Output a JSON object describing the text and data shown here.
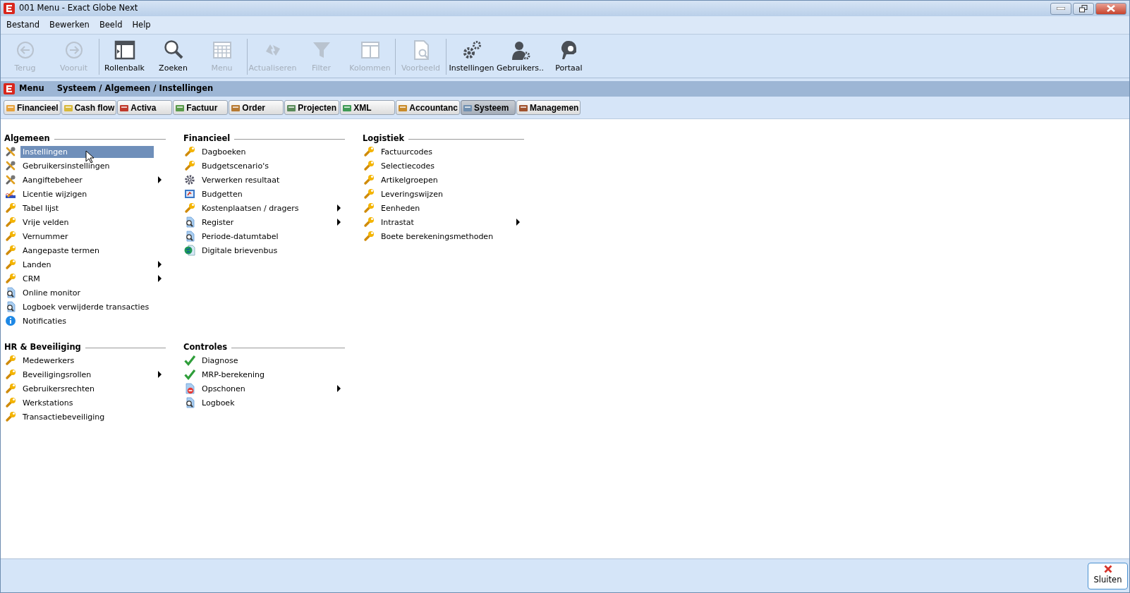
{
  "window": {
    "title": "001 Menu - Exact Globe Next"
  },
  "menu_bar": [
    {
      "label": "Bestand"
    },
    {
      "label": "Bewerken"
    },
    {
      "label": "Beeld"
    },
    {
      "label": "Help"
    }
  ],
  "toolbar": {
    "groups": [
      [
        {
          "label": "Terug",
          "kind": "back",
          "disabled": true
        },
        {
          "label": "Vooruit",
          "kind": "forward",
          "disabled": true
        }
      ],
      [
        {
          "label": "Rollenbalk",
          "kind": "sidebar",
          "disabled": false
        },
        {
          "label": "Zoeken",
          "kind": "search",
          "disabled": false
        },
        {
          "label": "Menu",
          "kind": "grid",
          "disabled": true
        }
      ],
      [
        {
          "label": "Actualiseren",
          "kind": "refresh",
          "disabled": true
        },
        {
          "label": "Filter",
          "kind": "filter",
          "disabled": true
        },
        {
          "label": "Kolommen",
          "kind": "columns",
          "disabled": true
        }
      ],
      [
        {
          "label": "Voorbeeld",
          "kind": "preview",
          "disabled": true
        }
      ],
      [
        {
          "label": "Instellingen",
          "kind": "settings",
          "disabled": false
        },
        {
          "label": "Gebruikers..",
          "kind": "users",
          "disabled": false
        },
        {
          "label": "Portaal",
          "kind": "support",
          "disabled": false
        }
      ]
    ]
  },
  "breadcrumb": {
    "title": "Menu",
    "path": "Systeem / Algemeen / Instellingen"
  },
  "module_tabs": [
    {
      "label": "Financieel",
      "selected": false
    },
    {
      "label": "Cash flow",
      "selected": false
    },
    {
      "label": "Activa",
      "selected": false
    },
    {
      "label": "Factuur",
      "selected": false
    },
    {
      "label": "Order",
      "selected": false
    },
    {
      "label": "Projecten",
      "selected": false
    },
    {
      "label": "XML",
      "selected": false
    },
    {
      "label": "Accountanc",
      "selected": false
    },
    {
      "label": "Systeem",
      "selected": true
    },
    {
      "label": "Managemen",
      "selected": false
    }
  ],
  "section_rows": [
    [
      {
        "title": "Algemeen",
        "items": [
          {
            "label": "Instellingen",
            "kind": "tools",
            "selected": true,
            "has_submenu": false
          },
          {
            "label": "Gebruikersinstellingen",
            "kind": "tools",
            "selected": false,
            "has_submenu": false
          },
          {
            "label": "Aangiftebeheer",
            "kind": "tools",
            "selected": false,
            "has_submenu": true
          },
          {
            "label": "Licentie wijzigen",
            "kind": "pen",
            "selected": false,
            "has_submenu": false
          },
          {
            "label": "Tabel lijst",
            "kind": "wrench",
            "selected": false,
            "has_submenu": false
          },
          {
            "label": "Vrije velden",
            "kind": "wrench",
            "selected": false,
            "has_submenu": false
          },
          {
            "label": "Vernummer",
            "kind": "wrench",
            "selected": false,
            "has_submenu": false
          },
          {
            "label": "Aangepaste termen",
            "kind": "wrench",
            "selected": false,
            "has_submenu": false
          },
          {
            "label": "Landen",
            "kind": "wrench",
            "selected": false,
            "has_submenu": true
          },
          {
            "label": "CRM",
            "kind": "wrench",
            "selected": false,
            "has_submenu": true
          },
          {
            "label": "Online monitor",
            "kind": "search",
            "selected": false,
            "has_submenu": false
          },
          {
            "label": "Logboek verwijderde transacties",
            "kind": "search",
            "selected": false,
            "has_submenu": false
          },
          {
            "label": "Notificaties",
            "kind": "info",
            "selected": false,
            "has_submenu": false
          }
        ]
      },
      {
        "title": "Financieel",
        "items": [
          {
            "label": "Dagboeken",
            "kind": "wrench",
            "selected": false,
            "has_submenu": false
          },
          {
            "label": "Budgetscenario's",
            "kind": "wrench",
            "selected": false,
            "has_submenu": false
          },
          {
            "label": "Verwerken resultaat",
            "kind": "gear",
            "selected": false,
            "has_submenu": false
          },
          {
            "label": "Budgetten",
            "kind": "book",
            "selected": false,
            "has_submenu": false
          },
          {
            "label": "Kostenplaatsen / dragers",
            "kind": "wrench",
            "selected": false,
            "has_submenu": true
          },
          {
            "label": "Register",
            "kind": "search",
            "selected": false,
            "has_submenu": true
          },
          {
            "label": "Periode-datumtabel",
            "kind": "search",
            "selected": false,
            "has_submenu": false
          },
          {
            "label": "Digitale brievenbus",
            "kind": "globe",
            "selected": false,
            "has_submenu": false
          }
        ]
      },
      {
        "title": "Logistiek",
        "items": [
          {
            "label": "Factuurcodes",
            "kind": "wrench",
            "selected": false,
            "has_submenu": false
          },
          {
            "label": "Selectiecodes",
            "kind": "wrench",
            "selected": false,
            "has_submenu": false
          },
          {
            "label": "Artikelgroepen",
            "kind": "wrench",
            "selected": false,
            "has_submenu": false
          },
          {
            "label": "Leveringswijzen",
            "kind": "wrench",
            "selected": false,
            "has_submenu": false
          },
          {
            "label": "Eenheden",
            "kind": "wrench",
            "selected": false,
            "has_submenu": false
          },
          {
            "label": "Intrastat",
            "kind": "wrench",
            "selected": false,
            "has_submenu": true
          },
          {
            "label": "Boete berekeningsmethoden",
            "kind": "wrench",
            "selected": false,
            "has_submenu": false
          }
        ]
      }
    ],
    [
      {
        "title": "HR & Beveiliging",
        "items": [
          {
            "label": "Medewerkers",
            "kind": "wrench",
            "selected": false,
            "has_submenu": false
          },
          {
            "label": "Beveiligingsrollen",
            "kind": "wrench",
            "selected": false,
            "has_submenu": true
          },
          {
            "label": "Gebruikersrechten",
            "kind": "wrench",
            "selected": false,
            "has_submenu": false
          },
          {
            "label": "Werkstations",
            "kind": "wrench",
            "selected": false,
            "has_submenu": false
          },
          {
            "label": "Transactiebeveiliging",
            "kind": "wrench",
            "selected": false,
            "has_submenu": false
          }
        ]
      },
      {
        "title": "Controles",
        "items": [
          {
            "label": "Diagnose",
            "kind": "check",
            "selected": false,
            "has_submenu": false
          },
          {
            "label": "MRP-berekening",
            "kind": "check",
            "selected": false,
            "has_submenu": false
          },
          {
            "label": "Opschonen",
            "kind": "remove",
            "selected": false,
            "has_submenu": true
          },
          {
            "label": "Logboek",
            "kind": "search",
            "selected": false,
            "has_submenu": false
          }
        ]
      }
    ]
  ],
  "footer": {
    "close_button": "Sluiten"
  }
}
